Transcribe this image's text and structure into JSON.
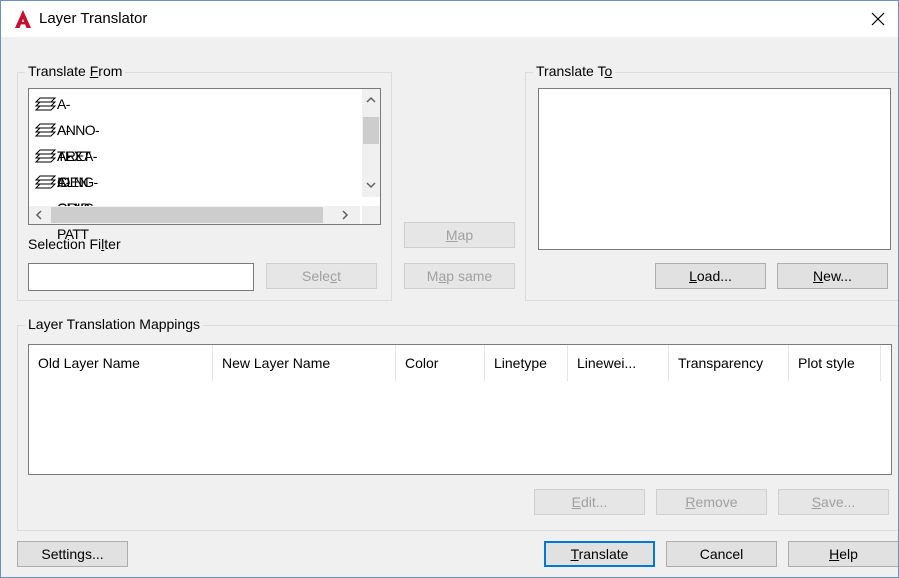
{
  "window": {
    "title": "Layer Translator",
    "accent": "#c8102e",
    "focus_color": "#0078d7"
  },
  "translate_from": {
    "legend_pre": "Translate ",
    "legend_mn": "F",
    "legend_post": "rom",
    "layers": [
      "A-ANNO-TEXT",
      "A-AREA-IDEN",
      "A-CLNG-GRID",
      "A-CLNG-PATT"
    ],
    "selection_filter_pre": "Selection Fi",
    "selection_filter_mn": "l",
    "selection_filter_post": "ter",
    "selection_filter_value": "",
    "select_pre": "Sele",
    "select_mn": "c",
    "select_post": "t"
  },
  "middle": {
    "map_pre": "",
    "map_mn": "M",
    "map_post": "ap",
    "map_same_pre": "M",
    "map_same_mn": "a",
    "map_same_post": "p same"
  },
  "translate_to": {
    "legend_pre": "Translate T",
    "legend_mn": "o",
    "legend_post": "",
    "load_pre": "",
    "load_mn": "L",
    "load_post": "oad...",
    "new_pre": "",
    "new_mn": "N",
    "new_post": "ew..."
  },
  "mappings": {
    "legend": "Layer Translation Mappings",
    "columns": [
      "Old Layer Name",
      "New Layer Name",
      "Color",
      "Linetype",
      "Linewei...",
      "Transparency",
      "Plot style"
    ],
    "edit_pre": "",
    "edit_mn": "E",
    "edit_post": "dit...",
    "remove_pre": "",
    "remove_mn": "R",
    "remove_post": "emove",
    "save_pre": "",
    "save_mn": "S",
    "save_post": "ave..."
  },
  "footer": {
    "settings": "Settings...",
    "translate_pre": "",
    "translate_mn": "T",
    "translate_post": "ranslate",
    "cancel": "Cancel",
    "help_pre": "",
    "help_mn": "H",
    "help_post": "elp"
  }
}
